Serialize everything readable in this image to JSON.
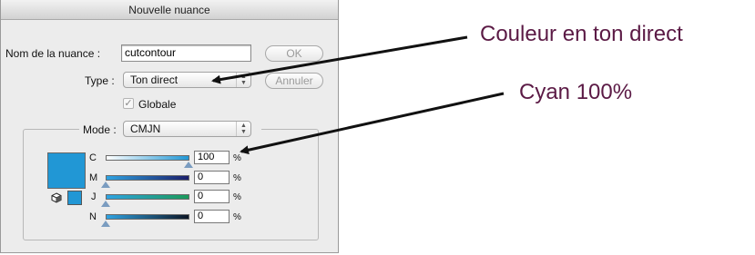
{
  "dialog": {
    "title": "Nouvelle nuance",
    "name_label": "Nom de la nuance :",
    "name_value": "cutcontour",
    "type_label": "Type :",
    "type_value": "Ton direct",
    "global_label": "Globale",
    "global_checked": true,
    "mode_label": "Mode :",
    "mode_value": "CMJN",
    "ok_label": "OK",
    "cancel_label": "Annuler"
  },
  "swatch_color": "#2197d5",
  "channels": [
    {
      "letter": "C",
      "value": "100",
      "unit": "%"
    },
    {
      "letter": "M",
      "value": "0",
      "unit": "%"
    },
    {
      "letter": "J",
      "value": "0",
      "unit": "%"
    },
    {
      "letter": "N",
      "value": "0",
      "unit": "%"
    }
  ],
  "annotations": {
    "spot_color": "Couleur en ton direct",
    "cyan": "Cyan 100%",
    "color": "#5b1a45"
  }
}
